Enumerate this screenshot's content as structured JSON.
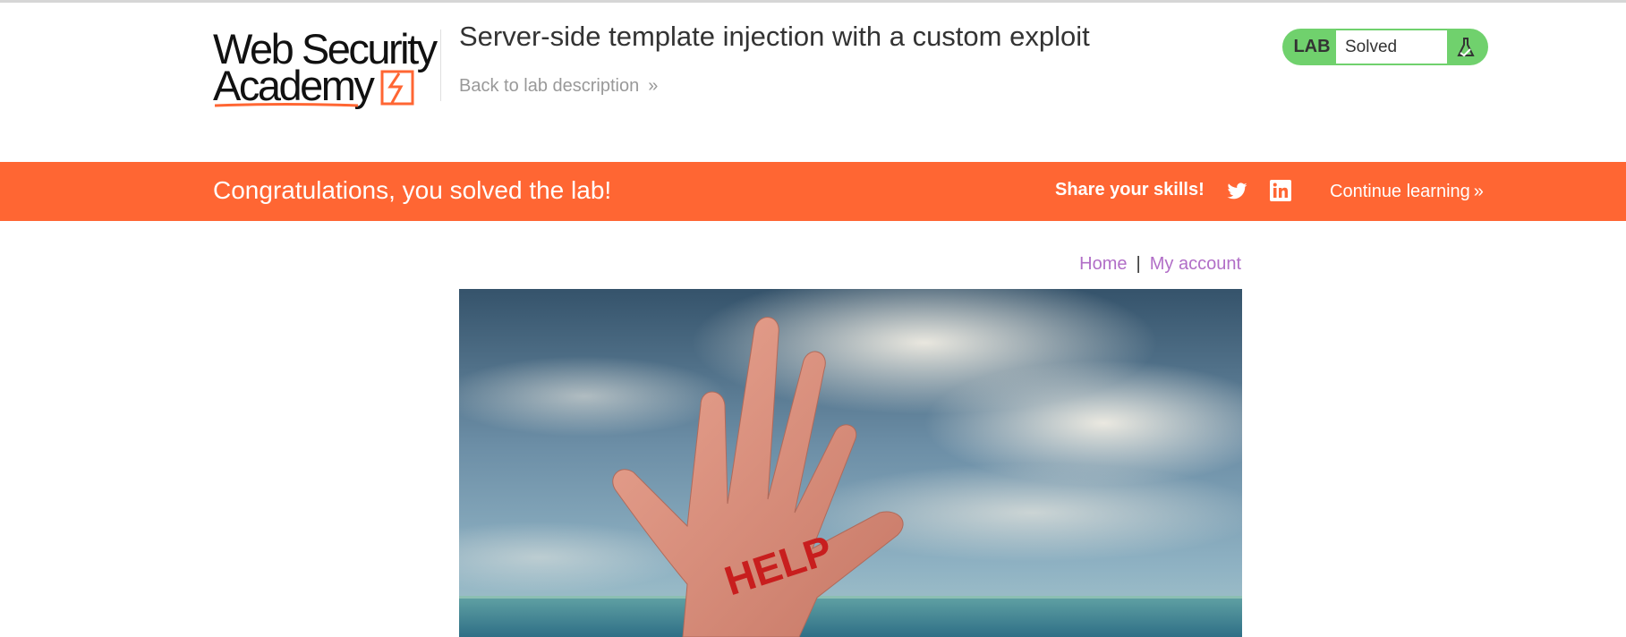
{
  "header": {
    "logo_line1": "Web Security",
    "logo_line2": "Academy",
    "lab_title": "Server-side template injection with a custom exploit",
    "back_link": "Back to lab description",
    "back_link_chevron": "»"
  },
  "lab_status": {
    "tag": "LAB",
    "value": "Solved",
    "icon": "flask-check-icon",
    "accent_color": "#70d16d"
  },
  "banner": {
    "message": "Congratulations, you solved the lab!",
    "share_label": "Share your skills!",
    "continue_label": "Continue learning",
    "continue_chevron": "»",
    "background_color": "#ff6633",
    "icons": [
      "twitter-icon",
      "linkedin-icon"
    ]
  },
  "nav": {
    "home": "Home",
    "separator": "|",
    "account": "My account",
    "link_color": "#b16ec7"
  },
  "hero": {
    "hand_text": "HELP"
  }
}
